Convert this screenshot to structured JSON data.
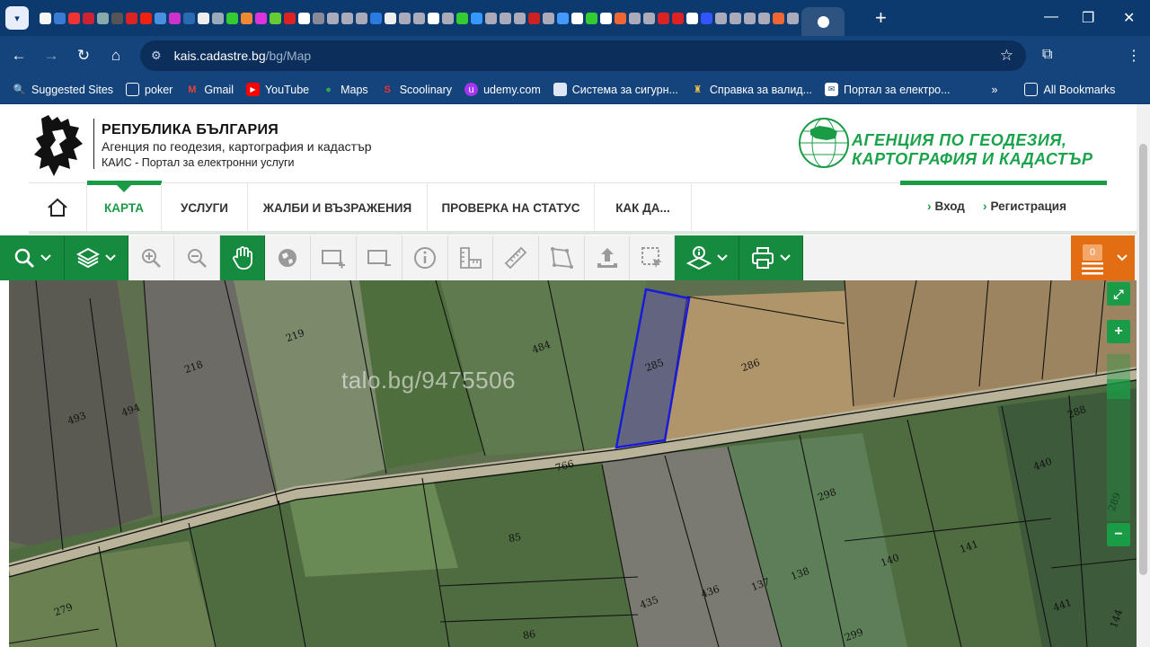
{
  "browser": {
    "url_host": "kais.cadastre.bg",
    "url_path": "/bg/Map",
    "bookmarks": [
      {
        "label": "Suggested Sites",
        "icon": "ie-icon"
      },
      {
        "label": "poker",
        "icon": "folder-icon"
      },
      {
        "label": "Gmail",
        "icon": "gmail-icon"
      },
      {
        "label": "YouTube",
        "icon": "youtube-icon"
      },
      {
        "label": "Maps",
        "icon": "maps-icon"
      },
      {
        "label": "Scoolinary",
        "icon": "scoolinary-icon"
      },
      {
        "label": "udemy.com",
        "icon": "udemy-icon"
      },
      {
        "label": "Система за сигурн...",
        "icon": "doc-icon"
      },
      {
        "label": "Справка за валид...",
        "icon": "crest-icon"
      },
      {
        "label": "Портал за електро...",
        "icon": "mail-icon"
      }
    ],
    "more_bookmarks": "»",
    "all_bookmarks": "All Bookmarks"
  },
  "header": {
    "title": "РЕПУБЛИКА БЪЛГАРИЯ",
    "agency": "Агенция по геодезия, картография и кадастър",
    "portal": "КАИС - Портал за електронни услуги",
    "brand_line1": "АГЕНЦИЯ ПО ГЕОДЕЗИЯ,",
    "brand_line2": "КАРТОГРАФИЯ И КАДАСТЪР"
  },
  "nav": {
    "items": [
      "КАРТА",
      "УСЛУГИ",
      "ЖАЛБИ И ВЪЗРАЖЕНИЯ",
      "ПРОВЕРКА НА СТАТУС",
      "КАК ДА..."
    ],
    "login": "Вход",
    "register": "Регистрация"
  },
  "cart": {
    "count": "0"
  },
  "map": {
    "watermark": "talo.bg/9475506",
    "selected_parcel": "285",
    "parcels": [
      "219",
      "218",
      "493",
      "494",
      "484",
      "285",
      "286",
      "288",
      "766",
      "440",
      "298",
      "289",
      "85",
      "141",
      "140",
      "138",
      "137",
      "436",
      "435",
      "279",
      "441",
      "86",
      "299",
      "144"
    ]
  },
  "colors": {
    "brand_green": "#1a9c46",
    "cart_orange": "#e36d12",
    "selection_blue": "#1a1adc"
  }
}
